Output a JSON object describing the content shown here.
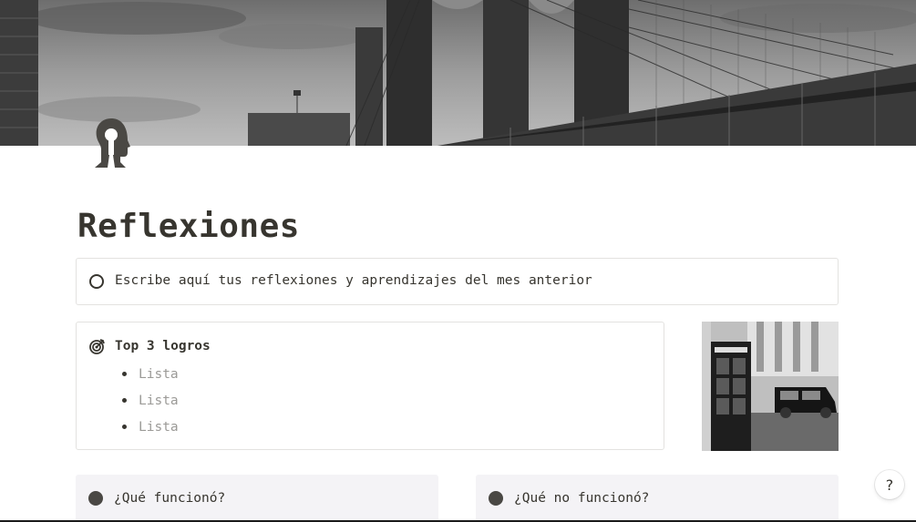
{
  "page": {
    "title": "Reflexiones",
    "cover_image": "brooklyn-bridge-bw-photo",
    "icon": "head-keyhole-icon"
  },
  "callout": {
    "icon": "circle-outline-icon",
    "text": "Escribe aquí tus reflexiones y aprendizajes del mes anterior"
  },
  "logros": {
    "icon": "target-icon",
    "heading": "Top 3 logros",
    "items": [
      "Lista",
      "Lista",
      "Lista"
    ]
  },
  "side_photo": "london-phone-booth-taxi-photo",
  "cards": {
    "funciono": {
      "icon": "filled-circle-icon",
      "label": "¿Qué funcionó?"
    },
    "no_funciono": {
      "icon": "filled-circle-icon",
      "label": "¿Qué no funcionó?"
    }
  },
  "help": {
    "label": "?"
  },
  "colors": {
    "text": "#37352f",
    "border": "#e3e2e0",
    "card_bg": "#f4f3f6",
    "muted": "#9b9a97"
  }
}
